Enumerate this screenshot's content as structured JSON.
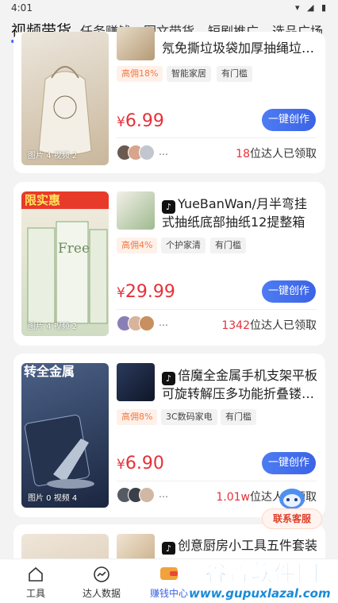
{
  "status_bar": {
    "time": "4:01"
  },
  "tabs": [
    {
      "label": "视频带货"
    },
    {
      "label": "任务赚钱"
    },
    {
      "label": "图文带货"
    },
    {
      "label": "短剧推广"
    },
    {
      "label": "选品广场"
    }
  ],
  "products": [
    {
      "title": "氖免撕垃圾袋加厚抽绳垃…",
      "tags": [
        "高佣18%",
        "智能家居",
        "有门槛"
      ],
      "price_symbol": "¥",
      "price": "6.99",
      "button": "一键创作",
      "dots": "…",
      "claimed_count": "18",
      "claimed_suffix": "位达人已领取",
      "thumb_count": "图片 4   视频 2",
      "thumb_colors": [
        "#e9e2d6",
        "#cbbba2"
      ]
    },
    {
      "title": "YueBanWan/月半弯挂式抽纸底部抽纸12提整箱可…",
      "tags": [
        "高佣4%",
        "个护家清",
        "有门槛"
      ],
      "price_symbol": "¥",
      "price": "29.99",
      "button": "一键创作",
      "dots": "…",
      "claimed_count": "1342",
      "claimed_suffix": "位达人已领取",
      "thumb_banner": "限实惠",
      "thumb_brand": "Free",
      "thumb_count": "图片 4   视频 2",
      "thumb_colors": [
        "#dfe8d6",
        "#9db68a"
      ]
    },
    {
      "title": "倍魔全金属手机支架平板可旋转解压多功能折叠镂…",
      "tags": [
        "高佣8%",
        "3C数码家电",
        "有门槛"
      ],
      "price_symbol": "¥",
      "price": "6.90",
      "button": "一键创作",
      "dots": "…",
      "claimed_count": "1.01w",
      "claimed_suffix": "位达人已领取",
      "thumb_banner": "转全金属",
      "thumb_count": "图片 0   视频 4",
      "thumb_colors": [
        "#3c4f74",
        "#1e2b45"
      ]
    },
    {
      "title": "创意厨房小工具五件套装",
      "thumb_colors": [
        "#efe6da",
        "#d9c7ae"
      ]
    }
  ],
  "service": {
    "label": "联系客服"
  },
  "bottom_nav": [
    {
      "label": "工具",
      "icon": "home-icon"
    },
    {
      "label": "达人数据",
      "icon": "chart-icon"
    },
    {
      "label": "赚钱中心",
      "icon": "wallet-icon"
    }
  ],
  "watermark": {
    "title": "谷普软件园",
    "url": "www.gupuxlazal.com"
  },
  "colors": {
    "accent": "#3b63e6",
    "price": "#e5313a",
    "commission": "#f07840"
  }
}
